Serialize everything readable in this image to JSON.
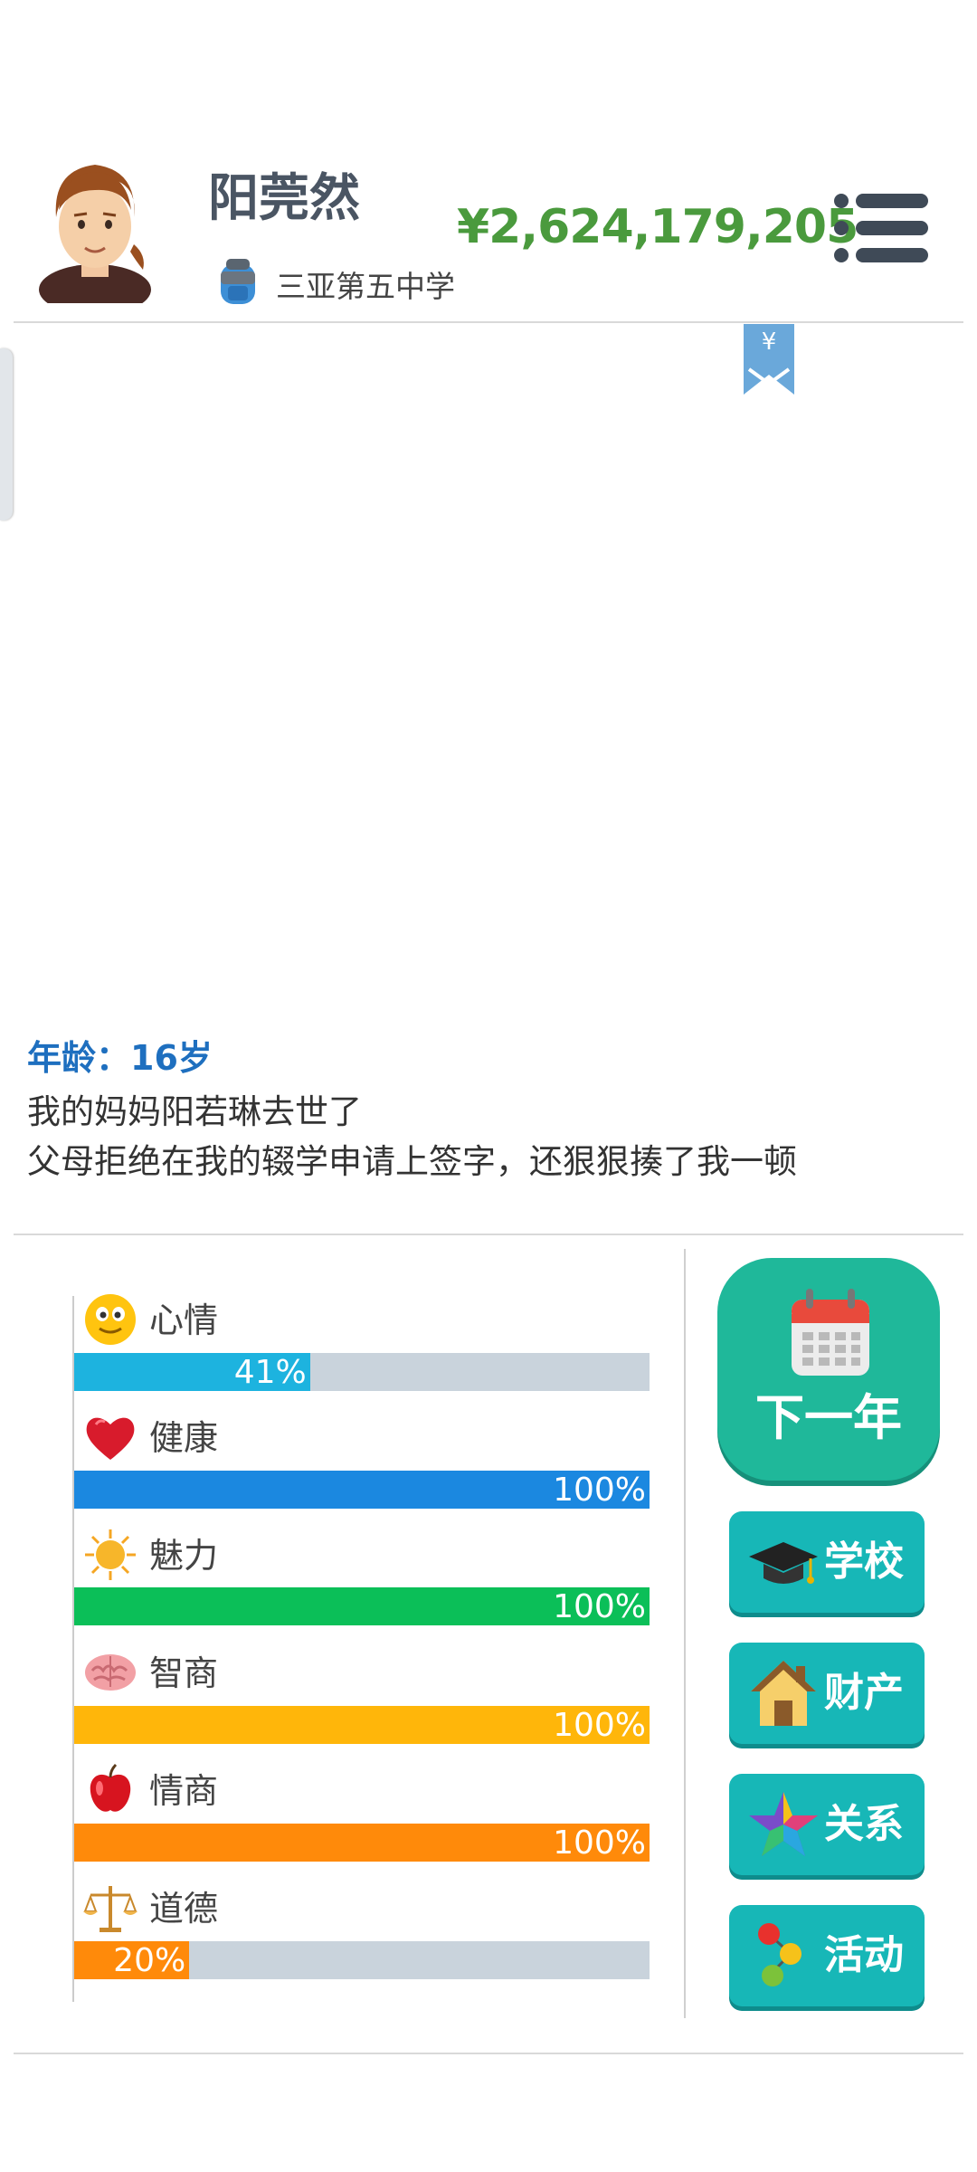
{
  "header": {
    "player_name": "阳莞然",
    "school": "三亚第五中学",
    "money": "¥2,624,179,205",
    "money_color": "#4a9a3d",
    "avatar_icon": "boy-avatar",
    "school_icon": "schoolbag-icon",
    "menu_icon": "menu-list-icon",
    "bookmark_symbol": "¥"
  },
  "events": {
    "age_line": "年龄：16岁",
    "lines": [
      "我的妈妈阳若琳去世了",
      "父母拒绝在我的辍学申请上签字，还狠狠揍了我一顿"
    ]
  },
  "stats": [
    {
      "label": "心情",
      "percent": 41,
      "percent_text": "41%",
      "color": "#1db3df",
      "icon": "smiley-icon"
    },
    {
      "label": "健康",
      "percent": 100,
      "percent_text": "100%",
      "color": "#1b88e0",
      "icon": "heart-icon"
    },
    {
      "label": "魅力",
      "percent": 100,
      "percent_text": "100%",
      "color": "#0bbf58",
      "icon": "sun-icon"
    },
    {
      "label": "智商",
      "percent": 100,
      "percent_text": "100%",
      "color": "#ffb60a",
      "icon": "brain-icon"
    },
    {
      "label": "情商",
      "percent": 100,
      "percent_text": "100%",
      "color": "#ff8a0a",
      "icon": "apple-icon"
    },
    {
      "label": "道德",
      "percent": 20,
      "percent_text": "20%",
      "color": "#ff8a0a",
      "icon": "scales-icon"
    }
  ],
  "buttons": {
    "next_year": "下一年",
    "school": "学校",
    "assets": "财产",
    "relations": "关系",
    "activities": "活动"
  }
}
